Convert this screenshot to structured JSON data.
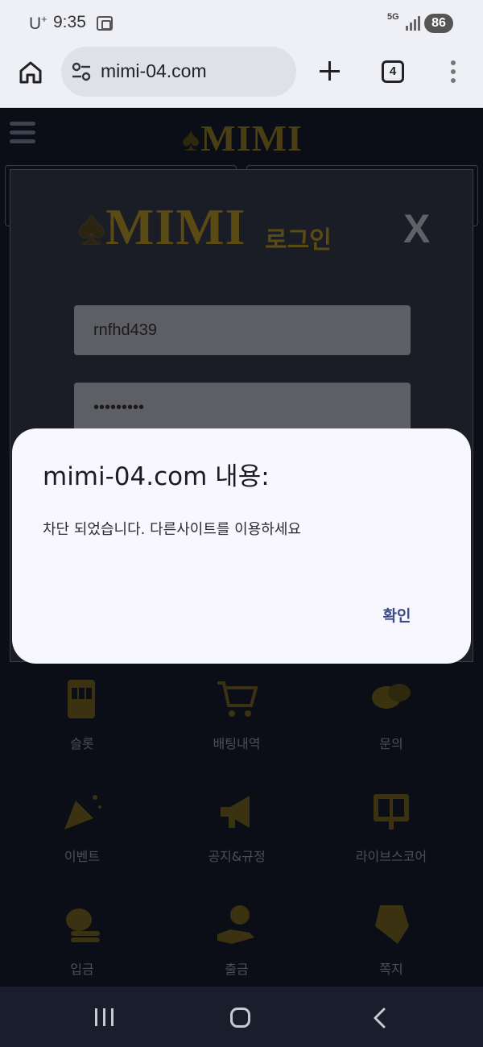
{
  "status_bar": {
    "carrier": "U",
    "carrier_sup": "+",
    "time": "9:35",
    "network": "5G",
    "battery": "86"
  },
  "browser": {
    "url": "mimi-04.com",
    "tab_count": "4"
  },
  "site": {
    "logo": "MIMI",
    "grid": [
      {
        "label": "슬롯",
        "icon": "slot-machine-icon"
      },
      {
        "label": "배팅내역",
        "icon": "cart-icon"
      },
      {
        "label": "문의",
        "icon": "chat-bubbles-icon"
      },
      {
        "label": "이벤트",
        "icon": "party-popper-icon"
      },
      {
        "label": "공지&규정",
        "icon": "megaphone-icon"
      },
      {
        "label": "라이브스코어",
        "icon": "scoreboard-icon"
      },
      {
        "label": "입금",
        "icon": "coins-icon"
      },
      {
        "label": "출금",
        "icon": "hand-coin-icon"
      },
      {
        "label": "쪽지",
        "icon": "envelope-icon"
      }
    ]
  },
  "login_modal": {
    "logo": "MIMI",
    "subtitle": "로그인",
    "close": "X",
    "username": "rnfhd439",
    "password": "•••••••••"
  },
  "alert": {
    "title": "mimi-04.com 내용:",
    "message": "차단 되었습니다. 다른사이트를 이용하세요",
    "ok_label": "확인"
  },
  "colors": {
    "accent_gold": "#d4a017",
    "dialog_bg": "#f8f7fd",
    "ok_button": "#3a4a8a"
  }
}
